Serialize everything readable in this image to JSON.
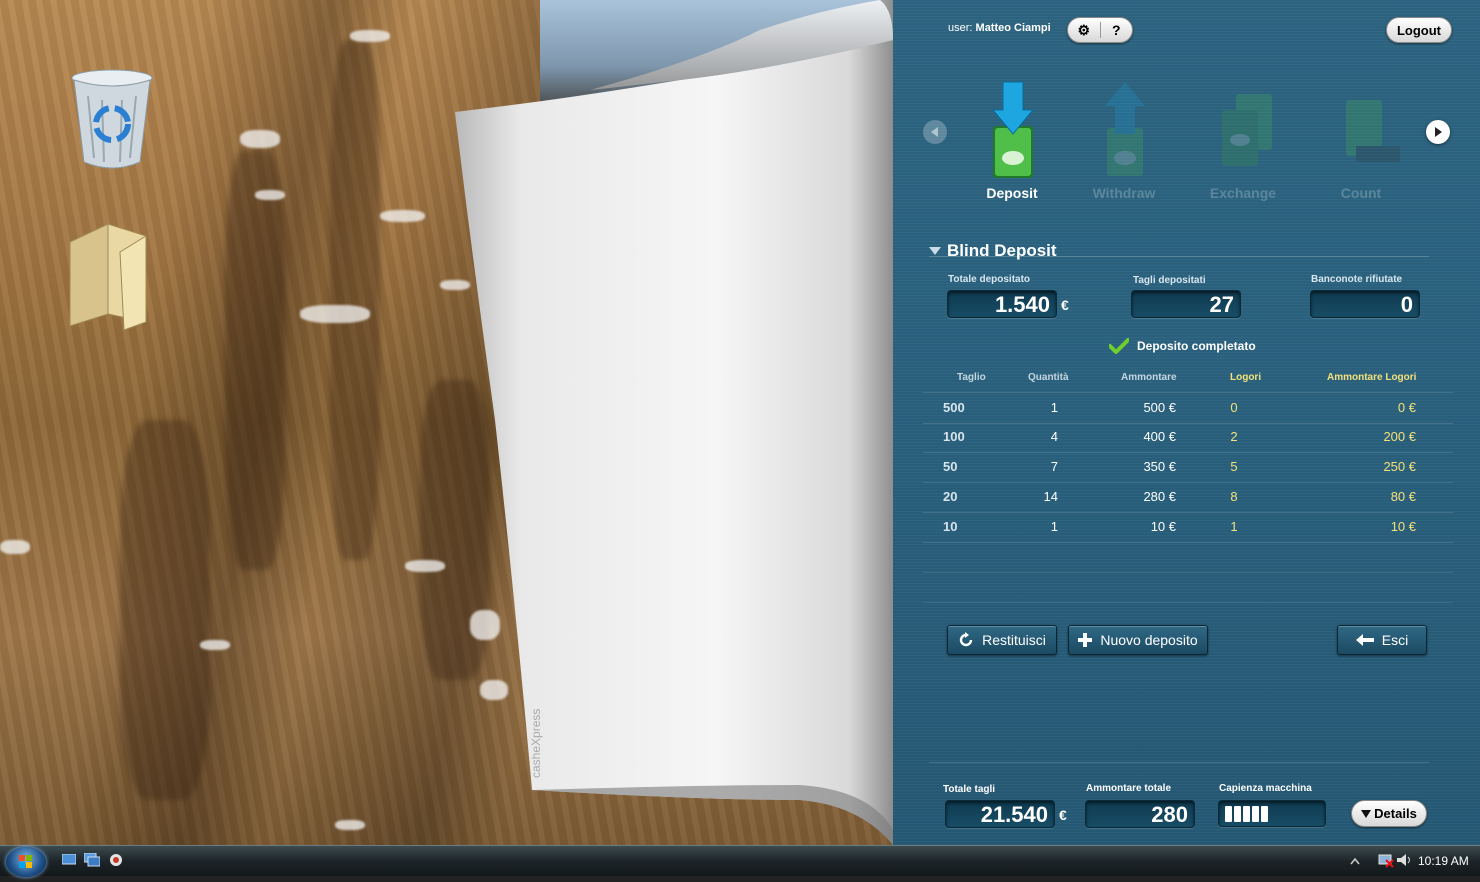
{
  "desktop": {
    "icons": [
      {
        "name": "recycle-bin"
      },
      {
        "name": "folder"
      }
    ],
    "page_watermark": "casheXpress"
  },
  "header": {
    "user_prefix": "user:",
    "user_name": "Matteo Ciampi",
    "settings_glyph": "⚙",
    "help_glyph": "?",
    "logout_label": "Logout"
  },
  "operations": [
    {
      "label": "Deposit",
      "active": true
    },
    {
      "label": "Withdraw",
      "active": false
    },
    {
      "label": "Exchange",
      "active": false
    },
    {
      "label": "Count",
      "active": false
    }
  ],
  "section": {
    "title": "Blind Deposit"
  },
  "summary": {
    "totale_label": "Totale depositato",
    "totale_value": "1.540",
    "currency": "€",
    "tagli_label": "Tagli depositati",
    "tagli_value": "27",
    "rifiutate_label": "Banconote rifiutate",
    "rifiutate_value": "0"
  },
  "status": {
    "text": "Deposito completato"
  },
  "table": {
    "headers": [
      "Taglio",
      "Quantità",
      "Ammontare",
      "Logori",
      "Ammontare Logori"
    ],
    "rows": [
      [
        "500",
        "1",
        "500 €",
        "0",
        "0 €"
      ],
      [
        "100",
        "4",
        "400 €",
        "2",
        "200 €"
      ],
      [
        "50",
        "7",
        "350 €",
        "5",
        "250 €"
      ],
      [
        "20",
        "14",
        "280 €",
        "8",
        "80 €"
      ],
      [
        "10",
        "1",
        "10 €",
        "1",
        "10 €"
      ]
    ]
  },
  "actions": {
    "restituisci": "Restituisci",
    "nuovo": "Nuovo deposito",
    "esci": "Esci"
  },
  "footer": {
    "totale_tagli_label": "Totale tagli",
    "totale_tagli_value": "21.540",
    "currency": "€",
    "ammontare_label": "Ammontare totale",
    "ammontare_value": "280",
    "capienza_label": "Capienza macchina",
    "capienza_level": 0.38,
    "details_label": "Details"
  },
  "taskbar": {
    "clock": "10:19 AM"
  },
  "colors": {
    "panel": "#2b6380",
    "accent_yellow": "#f3e07a",
    "check_green": "#6fcf2e"
  }
}
